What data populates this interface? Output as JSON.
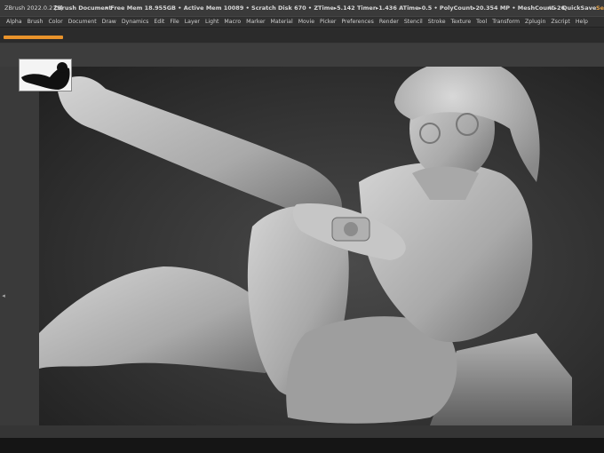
{
  "titlebar": {
    "app_title": "ZBrush 2022.0.2 [S]",
    "doc_title": "ZBrush Document",
    "stats": "• Free Mem 18.955GB • Active Mem 10089 • Scratch Disk 670 • ZTime▸5.142 Timer▸1.436 ATime▸0.5 • PolyCount▸20.354 MP • MeshCount▸26",
    "ac": "AC",
    "quicksave": "QuickSave",
    "see": "See"
  },
  "menubar": {
    "items": [
      "Alpha",
      "Brush",
      "Color",
      "Document",
      "Draw",
      "Dynamics",
      "Edit",
      "File",
      "Layer",
      "Light",
      "Macro",
      "Marker",
      "Material",
      "Movie",
      "Picker",
      "Preferences",
      "Render",
      "Stencil",
      "Stroke",
      "Texture",
      "Tool",
      "Transform",
      "Zplugin",
      "Zscript",
      "Help"
    ]
  },
  "colors": {
    "accent": "#e9932b",
    "background": "#2a2a2a",
    "clay": "#bdbdbd"
  },
  "icons": {
    "tray_handle": "double-chevron-icon",
    "bottom_handle": "double-chevron-icon"
  }
}
